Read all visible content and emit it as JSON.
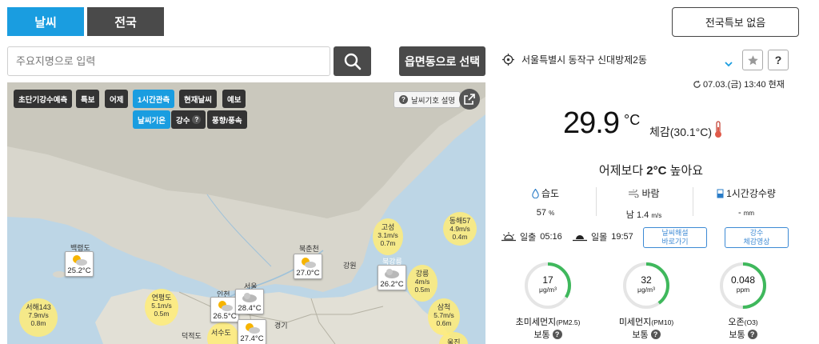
{
  "tabs": [
    {
      "label": "날씨"
    },
    {
      "label": "전국"
    }
  ],
  "search": {
    "placeholder": "주요지명으로 입력"
  },
  "emd_button": "읍면동으로 선택",
  "warning_button": "전국특보 없음",
  "map": {
    "buttons_row1": [
      "초단기강수예측",
      "특보",
      "어제",
      "1시간관측",
      "현재날씨",
      "예보"
    ],
    "buttons_row2": [
      "날씨기온",
      "강수",
      "풍향/풍속"
    ],
    "help_label": "날씨기호 설명",
    "cards": [
      {
        "name": "백령도",
        "temp": "25.2°C",
        "icon": "sun-cloud-icon"
      },
      {
        "name": "북춘천",
        "temp": "27.0°C",
        "icon": "sun-cloud-icon"
      },
      {
        "name": "북강릉",
        "temp": "26.2°C",
        "icon": "cloud-icon"
      },
      {
        "name": "인천",
        "temp": "26.5°C",
        "icon": "sun-cloud-icon"
      },
      {
        "name": "서울",
        "temp": "28.4°C",
        "icon": "cloud-icon"
      },
      {
        "name": "",
        "temp": "27.4°C",
        "icon": "sun-cloud-icon"
      }
    ],
    "blobs": [
      {
        "name": "동해57",
        "l1": "4.9m/s",
        "l2": "0.4m"
      },
      {
        "name": "고성",
        "l1": "3.1m/s",
        "l2": "0.7m"
      },
      {
        "name": "강릉",
        "l1": "4m/s",
        "l2": "0.5m"
      },
      {
        "name": "삼척",
        "l1": "5.7m/s",
        "l2": "0.6m"
      },
      {
        "name": "연평도",
        "l1": "5.1m/s",
        "l2": "0.5m"
      },
      {
        "name": "서해143",
        "l1": "7.9m/s",
        "l2": "0.8m"
      }
    ],
    "places": [
      "강원",
      "경기",
      "덕적도",
      "서수도",
      "울진"
    ]
  },
  "location": {
    "name": "서울특별시 동작구 신대방제2동",
    "time": "07.03.(금) 13:40 현재"
  },
  "current": {
    "temp": "29.9",
    "unit": "°C",
    "feels": "체감(30.1°C)",
    "compare_prefix": "어제보다 ",
    "compare_value": "2°C",
    "compare_suffix": " 높아요"
  },
  "stats": [
    {
      "label": "습도",
      "value": "57",
      "unit": "%"
    },
    {
      "label": "바람",
      "value": "남 1.4",
      "unit": "m/s"
    },
    {
      "label": "1시간강수량",
      "value": "-",
      "unit": "mm"
    }
  ],
  "sun": {
    "rise_label": "일출",
    "rise_time": "05:16",
    "set_label": "일몰",
    "set_time": "19:57"
  },
  "links": [
    {
      "line1": "날씨해설",
      "line2": "바로가기"
    },
    {
      "line1": "강수",
      "line2": "체감영상"
    }
  ],
  "air": [
    {
      "value": "17",
      "unit": "μg/m³",
      "label": "초미세먼지",
      "sub": "(PM2.5)",
      "state": "보통",
      "fraction": 0.34
    },
    {
      "value": "32",
      "unit": "μg/m³",
      "label": "미세먼지",
      "sub": "(PM10)",
      "state": "보통",
      "fraction": 0.4
    },
    {
      "value": "0.048",
      "unit": "ppm",
      "label": "오존",
      "sub": "(O3)",
      "state": "보통",
      "fraction": 0.5
    }
  ],
  "colors": {
    "accent": "#1a9de0",
    "dark": "#4a4a4a",
    "air_good": "#3fb85c",
    "link": "#3d8ad4"
  }
}
